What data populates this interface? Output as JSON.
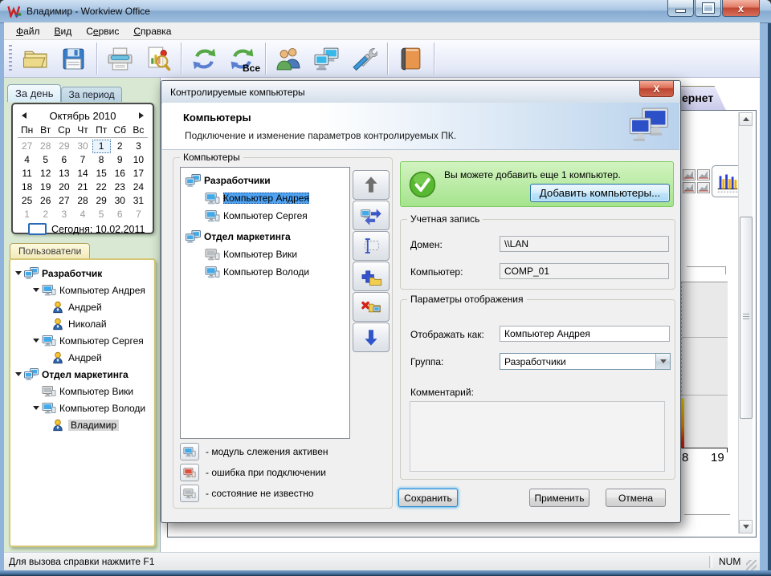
{
  "window": {
    "title": "Владимир - Workview Office"
  },
  "menu": {
    "items": [
      {
        "pre": "",
        "key": "Ф",
        "rest": "айл"
      },
      {
        "pre": "",
        "key": "В",
        "rest": "ид"
      },
      {
        "pre": "С",
        "key": "е",
        "rest": "рвис"
      },
      {
        "pre": "",
        "key": "С",
        "rest": "правка"
      }
    ]
  },
  "toolbar": {
    "refresh_all_label": "Все"
  },
  "sidebar": {
    "tab_day": "За день",
    "tab_period": "За период",
    "calendar": {
      "month": "Октябрь 2010",
      "weekdays": [
        "Пн",
        "Вт",
        "Ср",
        "Чт",
        "Пт",
        "Сб",
        "Вс"
      ],
      "days": [
        {
          "t": "27",
          "m": 1
        },
        {
          "t": "28",
          "m": 1
        },
        {
          "t": "29",
          "m": 1
        },
        {
          "t": "30",
          "m": 1
        },
        {
          "t": "1",
          "s": 1
        },
        {
          "t": "2"
        },
        {
          "t": "3"
        },
        {
          "t": "4"
        },
        {
          "t": "5"
        },
        {
          "t": "6"
        },
        {
          "t": "7"
        },
        {
          "t": "8"
        },
        {
          "t": "9"
        },
        {
          "t": "10"
        },
        {
          "t": "11"
        },
        {
          "t": "12"
        },
        {
          "t": "13"
        },
        {
          "t": "14"
        },
        {
          "t": "15"
        },
        {
          "t": "16"
        },
        {
          "t": "17"
        },
        {
          "t": "18"
        },
        {
          "t": "19"
        },
        {
          "t": "20"
        },
        {
          "t": "21"
        },
        {
          "t": "22"
        },
        {
          "t": "23"
        },
        {
          "t": "24"
        },
        {
          "t": "25"
        },
        {
          "t": "26"
        },
        {
          "t": "27"
        },
        {
          "t": "28"
        },
        {
          "t": "29"
        },
        {
          "t": "30"
        },
        {
          "t": "31"
        },
        {
          "t": "1",
          "m": 1
        },
        {
          "t": "2",
          "m": 1
        },
        {
          "t": "3",
          "m": 1
        },
        {
          "t": "4",
          "m": 1
        },
        {
          "t": "5",
          "m": 1
        },
        {
          "t": "6",
          "m": 1
        },
        {
          "t": "7",
          "m": 1
        }
      ],
      "today": "Сегодня: 10.02.2011"
    },
    "users_tab": "Пользователи",
    "tree": {
      "n0": "Разработчик",
      "n1": "Компьютер Андрея",
      "n2": "Андрей",
      "n3": "Николай",
      "n4": "Компьютер Сергея",
      "n5": "Андрей",
      "n6": "Отдел маркетинга",
      "n7": "Компьютер Вики",
      "n8": "Компьютер Володи",
      "n9": "Владимир"
    }
  },
  "background": {
    "tab_label": "ернет",
    "tick1": "8",
    "tick2": "19"
  },
  "dialog": {
    "title": "Контролируемые компьютеры",
    "header_title": "Компьютеры",
    "header_subtitle": "Подключение и изменение параметров контролируемых ПК.",
    "group_computers": "Компьютеры",
    "tree": {
      "g1": "Разработчики",
      "c1": "Компьютер Андрея",
      "c2": "Компьютер Сергея",
      "g2": "Отдел маркетинга",
      "c3": "Компьютер Вики",
      "c4": "Компьютер Володи"
    },
    "info_text": "Вы можете добавить еще 1 компьютер.",
    "add_button": "Добавить компьютеры...",
    "account": {
      "legend": "Учетная запись",
      "domain_label": "Домен:",
      "domain_value": "\\\\LAN",
      "computer_label": "Компьютер:",
      "computer_value": "COMP_01"
    },
    "display": {
      "legend": "Параметры отображения",
      "as_label": "Отображать как:",
      "as_value": "Компьютер Андрея",
      "group_label": "Группа:",
      "group_value": "Разработчики",
      "comment_label": "Комментарий:"
    },
    "legend": {
      "l1": "- модуль слежения активен",
      "l2": "- ошибка при подключении",
      "l3": "- состояние не известно"
    },
    "save": "Сохранить",
    "apply": "Применить",
    "cancel": "Отмена"
  },
  "statusbar": {
    "help": "Для вызова справки нажмите F1",
    "num": "NUM"
  }
}
